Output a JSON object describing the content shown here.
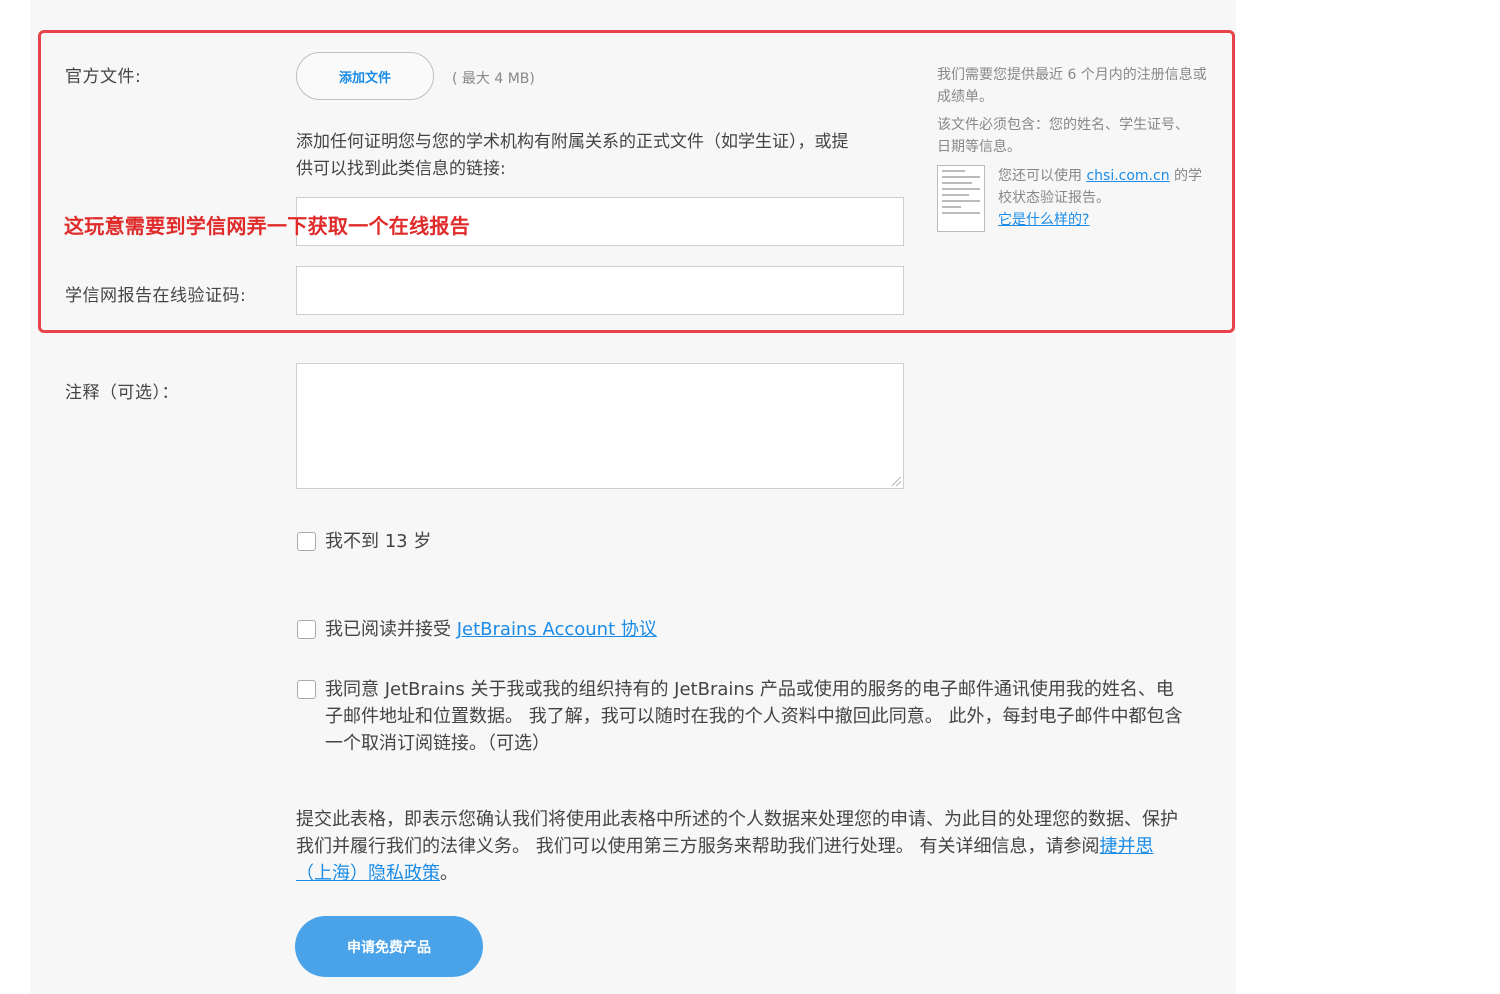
{
  "official_docs": {
    "label": "官方文件:",
    "add_file_button": "添加文件",
    "max_size": "( 最大 4 MB)",
    "description": "添加任何证明您与您的学术机构有附属关系的正式文件（如学生证），或提供可以找到此类信息的链接:",
    "link_input_value": ""
  },
  "annotation_text": "这玩意需要到学信网弄一下获取一个在线报告",
  "verification": {
    "label": "学信网报告在线验证码:",
    "input_value": ""
  },
  "side_notes": {
    "note1": "我们需要您提供最近 6 个月内的注册信息或成绩单。",
    "note2": "该文件必须包含：您的姓名、学生证号、日期等信息。",
    "note3_prefix": "您还可以使用 ",
    "note3_link": "chsi.com.cn",
    "note3_suffix": " 的学校状态验证报告。",
    "what_is_it_link": "它是什么样的?"
  },
  "comments": {
    "label": "注释（可选）：",
    "value": ""
  },
  "checkboxes": {
    "under_13": "我不到 13 岁",
    "agreement_prefix": "我已阅读并接受 ",
    "agreement_link": "JetBrains Account 协议",
    "marketing": "我同意 JetBrains 关于我或我的组织持有的 JetBrains 产品或使用的服务的电子邮件通讯使用我的姓名、电子邮件地址和位置数据。 我了解，我可以随时在我的个人资料中撤回此同意。 此外，每封电子邮件中都包含一个取消订阅链接。（可选）"
  },
  "privacy": {
    "text": "提交此表格，即表示您确认我们将使用此表格中所述的个人数据来处理您的申请、为此目的处理您的数据、保护我们并履行我们的法律义务。 我们可以使用第三方服务来帮助我们进行处理。 有关详细信息，请参阅",
    "link": "捷并思（上海）隐私政策",
    "suffix": "。"
  },
  "submit_button": "申请免费产品",
  "colors": {
    "accent_blue": "#1a8ce8",
    "button_blue": "#4aa3e8",
    "highlight_red": "#e8424a"
  }
}
